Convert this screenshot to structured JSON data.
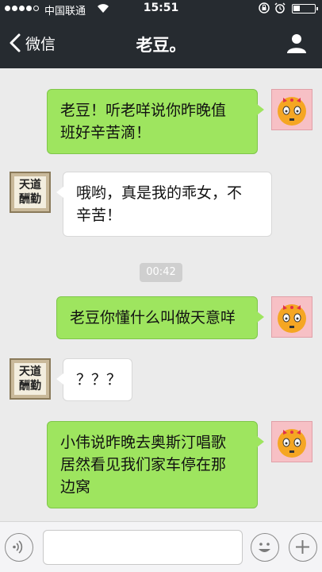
{
  "status_bar": {
    "carrier": "中国联通",
    "time": "15:51"
  },
  "nav": {
    "back_label": "微信",
    "title": "老豆。"
  },
  "messages": [
    {
      "side": "out",
      "text_lines": [
        "老豆！听老咩说你昨晚值",
        "班好辛苦滴！"
      ]
    },
    {
      "side": "in",
      "text_lines": [
        "哦哟，真是我的乖女，不",
        "辛苦！"
      ]
    },
    {
      "side": "timestamp",
      "text": "00:42"
    },
    {
      "side": "out",
      "text_lines": [
        "老豆你懂什么叫做天意咩"
      ]
    },
    {
      "side": "in",
      "text_lines": [
        "？？？"
      ]
    },
    {
      "side": "out",
      "text_lines": [
        "小伟说昨晚去奥斯汀唱歌",
        "居然看见我们家车停在那",
        "边窝"
      ]
    }
  ],
  "avatar_calligraphy": "天道酬勤",
  "input": {
    "value": ""
  },
  "colors": {
    "nav_bg": "#262b30",
    "chat_bg": "#ebebeb",
    "bubble_out": "#9ee55f",
    "bubble_in": "#ffffff"
  }
}
